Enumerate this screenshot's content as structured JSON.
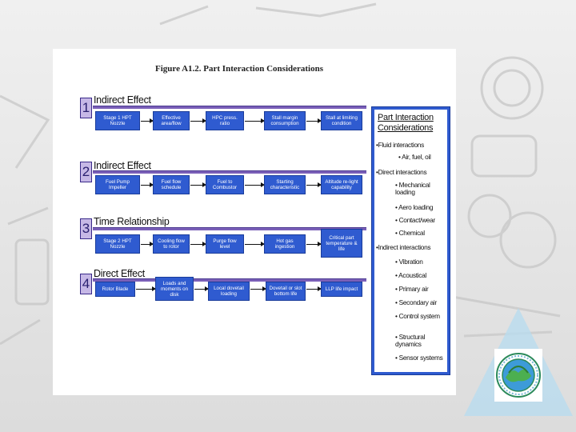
{
  "figure": {
    "title": "Figure A1.2.  Part Interaction Considerations"
  },
  "rows": [
    {
      "number": "1",
      "title": "Indirect Effect",
      "boxes": [
        "Stage 1 HPT Nozzle",
        "Effective area/flow",
        "HPC press. ratio",
        "Stall margin consumption",
        "Stall at limiting condition"
      ]
    },
    {
      "number": "2",
      "title": "Indirect Effect",
      "boxes": [
        "Fuel Pump Impeller",
        "Fuel flow schedule",
        "Fuel to Combustor",
        "Starting characteristic",
        "Altitude re-light capability"
      ]
    },
    {
      "number": "3",
      "title": "Time Relationship",
      "boxes": [
        "Stage 2 HPT Nozzle",
        "Cooling flow to rotor",
        "Purge flow level",
        "Hot gas ingestion",
        "Critical part temperature & life"
      ]
    },
    {
      "number": "4",
      "title": "Direct Effect",
      "boxes": [
        "Rotor Blade",
        "Loads and moments on disk",
        "Local dovetail loading",
        "Dovetail or slot bottom life",
        "LLP life impact"
      ]
    }
  ],
  "panel": {
    "title": "Part Interaction Considerations",
    "items": [
      "•Fluid interactions",
      "• Air, fuel, oil",
      "•Direct interactions",
      "• Mechanical loading",
      "• Aero loading",
      "• Contact/wear",
      "• Chemical",
      "•Indirect interactions",
      "• Vibration",
      "• Acoustical",
      "• Primary air",
      "• Secondary air",
      "• Control system",
      "• Structural dynamics",
      "• Sensor systems"
    ]
  },
  "colors": {
    "box_fill": "#2f5bd0",
    "number_fill": "#c6b8e6",
    "accent_line": "#7a5fb8"
  },
  "icons": [
    "arrow-right-icon",
    "organization-seal-icon"
  ]
}
